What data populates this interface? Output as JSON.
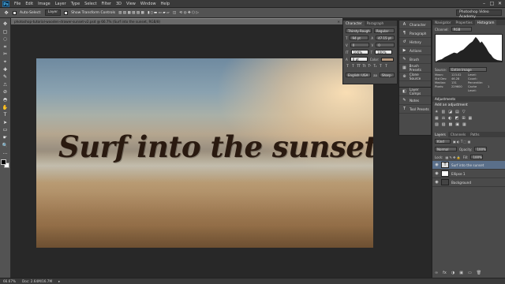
{
  "app": {
    "logo": "Ps",
    "workspace": "Photoshop Video Academy"
  },
  "menu": [
    "File",
    "Edit",
    "Image",
    "Layer",
    "Type",
    "Select",
    "Filter",
    "3D",
    "View",
    "Window",
    "Help"
  ],
  "window_controls": [
    "–",
    "□",
    "✕"
  ],
  "options": {
    "auto_select_label": "Auto-Select:",
    "auto_select_value": "Layer",
    "transform_label": "Show Transform Controls"
  },
  "document": {
    "tab_title": "photoshop-tutorial-wooden-drawer-sunset-v2.psd @ 66.7% (Surf into the sunset, RGB/8)",
    "headline": "Surf into the sunset."
  },
  "status": {
    "zoom": "66.67%",
    "doc_size": "Doc: 2.64M/16.7M"
  },
  "character": {
    "tabs": [
      "Character",
      "Paragraph"
    ],
    "font": "Thirsty Rough",
    "style": "Regular",
    "size": "94 pt",
    "leading": "47.15 pt",
    "kerning": "0",
    "tracking": "0",
    "vscale": "100%",
    "hscale": "100%",
    "baseline": "0 pt",
    "color_label": "Color:",
    "language": "English: USA",
    "aa": "Sharp",
    "type_style_icons": [
      "T",
      "T",
      "TT",
      "Tt",
      "T¹",
      "T₁",
      "T",
      "T"
    ]
  },
  "icon_panel": {
    "items": [
      {
        "icon": "A",
        "label": "Character"
      },
      {
        "icon": "¶",
        "label": "Paragraph"
      },
      {
        "icon": "↺",
        "label": "History"
      },
      {
        "icon": "▶",
        "label": "Actions"
      },
      {
        "icon": "✎",
        "label": "Brush"
      },
      {
        "icon": "▦",
        "label": "Brush Presets"
      },
      {
        "icon": "⊕",
        "label": "Clone Source"
      }
    ],
    "items2": [
      {
        "icon": "◧",
        "label": "Layer Comps"
      },
      {
        "icon": "✎",
        "label": "Notes"
      },
      {
        "icon": "T",
        "label": "Tool Presets"
      }
    ]
  },
  "histogram": {
    "tabs": [
      "Navigator",
      "Properties",
      "Histogram"
    ],
    "active": "Histogram",
    "channel_label": "Channel:",
    "channel": "RGB",
    "source_label": "Source:",
    "source": "Entire Image",
    "stats": [
      "Mean:",
      "123.02",
      "Level:",
      "",
      "Std Dev:",
      "46.28",
      "Count:",
      "",
      "Median:",
      "131",
      "Percentile:",
      "",
      "Pixels:",
      "229600",
      "Cache Level:",
      "1"
    ]
  },
  "adjustments": {
    "tab": "Adjustments",
    "title": "Add an adjustment",
    "row1": [
      "☀",
      "▥",
      "◪",
      "▤",
      "▽"
    ],
    "row2": [
      "▦",
      "⚖",
      "◐",
      "◩",
      "⊞",
      "▦"
    ],
    "row3": [
      "▨",
      "▧",
      "▩",
      "▣",
      "▦"
    ]
  },
  "layers": {
    "tabs": [
      "Layers",
      "Channels",
      "Paths"
    ],
    "kind_label": "Kind",
    "blend_mode": "Normal",
    "opacity_label": "Opacity:",
    "opacity": "100%",
    "lock_label": "Lock:",
    "fill_label": "Fill:",
    "fill": "100%",
    "items": [
      {
        "name": "Surf into the sunset",
        "type": "text",
        "selected": true
      },
      {
        "name": "Ellipse 1",
        "type": "shape",
        "selected": false
      },
      {
        "name": "Background",
        "type": "image",
        "selected": false
      }
    ],
    "footer": [
      "∞",
      "fx",
      "◑",
      "▣",
      "▭",
      "🗑"
    ]
  },
  "tools": [
    "▭",
    "✥",
    "▢",
    "◌",
    "⌗",
    "✂",
    "⌖",
    "✚",
    "✎",
    "⎍",
    "⊘",
    "◓",
    "✋",
    "T",
    "➤",
    "▭",
    "☛",
    "🔍",
    "…"
  ],
  "colors": {
    "accent": "#5a6f8a",
    "panel": "#4a4a4a",
    "text_color": "#2a1a10"
  }
}
